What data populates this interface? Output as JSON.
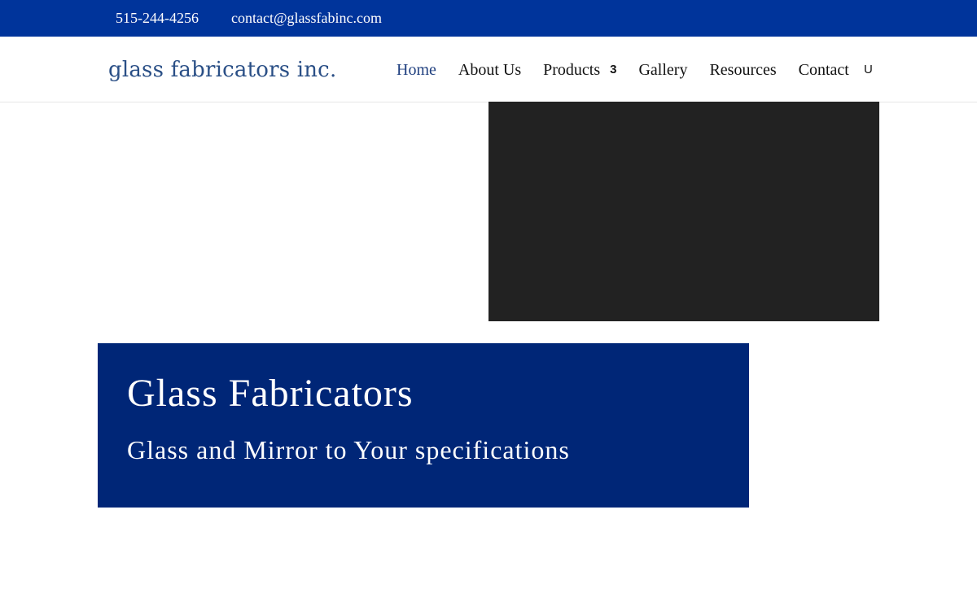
{
  "top_bar": {
    "phone": "515-244-4256",
    "email": "contact@glassfabinc.com",
    "background_color": "#00349b"
  },
  "header": {
    "logo_text": "glass fabricators inc.",
    "nav": [
      {
        "label": "Home",
        "active": true
      },
      {
        "label": "About Us"
      },
      {
        "label": "Products",
        "has_submenu": true,
        "submenu_icon": "3"
      },
      {
        "label": "Gallery"
      },
      {
        "label": "Resources"
      },
      {
        "label": "Contact"
      }
    ],
    "search_icon_glyph": "U",
    "active_color": "#1f3f7f"
  },
  "media": {
    "background_color": "#222222"
  },
  "hero": {
    "title": "Glass Fabricators",
    "subtitle": "Glass and Mirror to Your specifications",
    "background_color": "#002677"
  }
}
